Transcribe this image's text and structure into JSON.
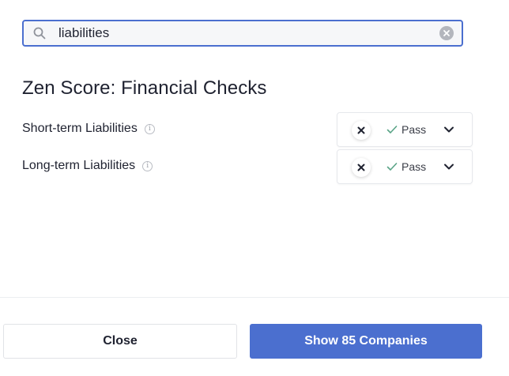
{
  "search": {
    "value": "liabilities",
    "icon": "search-icon",
    "clear_icon": "clear-icon"
  },
  "section": {
    "title": "Zen Score: Financial Checks",
    "checks": [
      {
        "label": "Short-term Liabilities",
        "status": "Pass"
      },
      {
        "label": "Long-term Liabilities",
        "status": "Pass"
      }
    ]
  },
  "footer": {
    "close_label": "Close",
    "show_label": "Show 85 Companies"
  },
  "colors": {
    "accent": "#4b6fcf",
    "pass_check": "#5aa487"
  }
}
